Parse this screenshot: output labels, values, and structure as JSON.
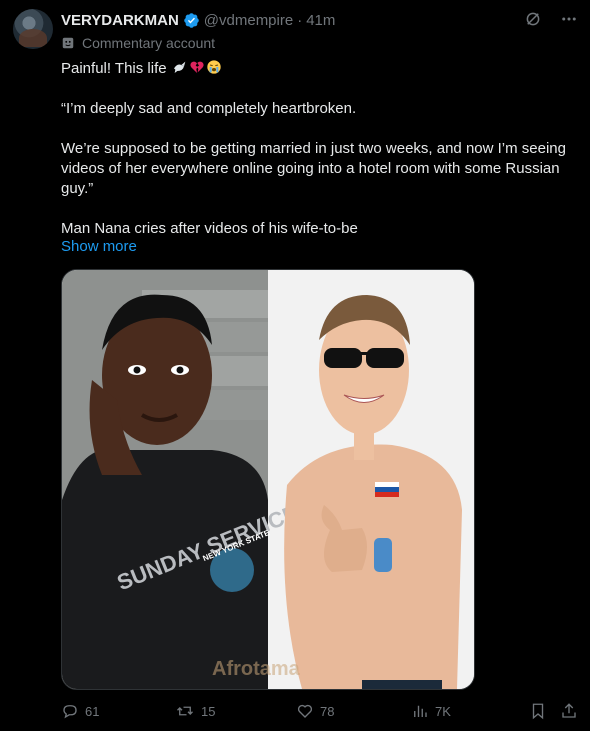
{
  "header": {
    "display_name": "VERYDARKMAN",
    "handle": "@vdmempire",
    "separator": "·",
    "time": "41m",
    "commentary_label": "Commentary account"
  },
  "tweet": {
    "line1": "Painful! This life",
    "quote": "“I’m deeply sad and completely heartbroken.",
    "line3": "We’re supposed to be getting married in just two weeks, and now I’m seeing videos of her everywhere online going into a hotel room with some Russian guy.”",
    "line4": "Man Nana cries after videos of his wife-to-be",
    "show_more": "Show more"
  },
  "media": {
    "shirt_text": "SUNDAY SERVICE",
    "badge_text": "NEW YORK STATE",
    "watermark": "Afrotama"
  },
  "actions": {
    "replies": "61",
    "reposts": "15",
    "likes": "78",
    "views": "7K"
  },
  "colors": {
    "background": "#000000",
    "text": "#e7e9ea",
    "muted": "#71767b",
    "link": "#1d9bf0",
    "verified": "#1d9bf0"
  },
  "icons": [
    "verified-badge-icon",
    "grok-icon",
    "more-icon",
    "theater-mask-icon",
    "dove-emoji",
    "broken-heart-emoji",
    "crying-face-emoji",
    "reply-icon",
    "repost-icon",
    "like-icon",
    "views-icon",
    "bookmark-icon",
    "share-icon"
  ]
}
